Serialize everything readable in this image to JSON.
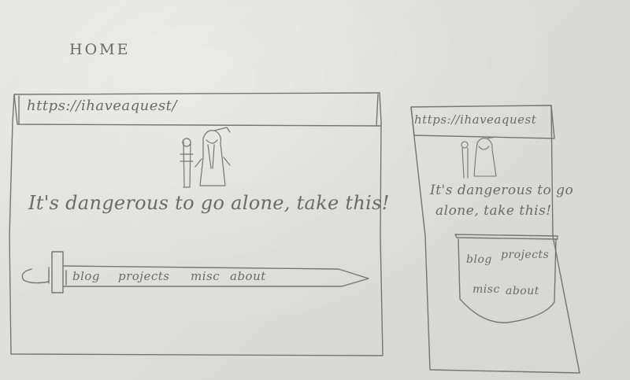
{
  "page_title": "HOME",
  "desktop": {
    "url": "https://ihaveaquest/",
    "tagline": "It's dangerous to go alone, take this!",
    "nav": [
      "blog",
      "projects",
      "misc",
      "about"
    ]
  },
  "mobile": {
    "url": "https://ihaveaquest",
    "tagline_line1": "It's dangerous to go",
    "tagline_line2": "alone, take this!",
    "nav": [
      "blog",
      "projects",
      "misc",
      "about"
    ]
  },
  "colors": {
    "paper": "#dddddb",
    "pencil": "#6c6c6c"
  },
  "icons": [
    "old-man-with-staff-icon",
    "sword-nav-icon",
    "shield-nav-icon"
  ]
}
